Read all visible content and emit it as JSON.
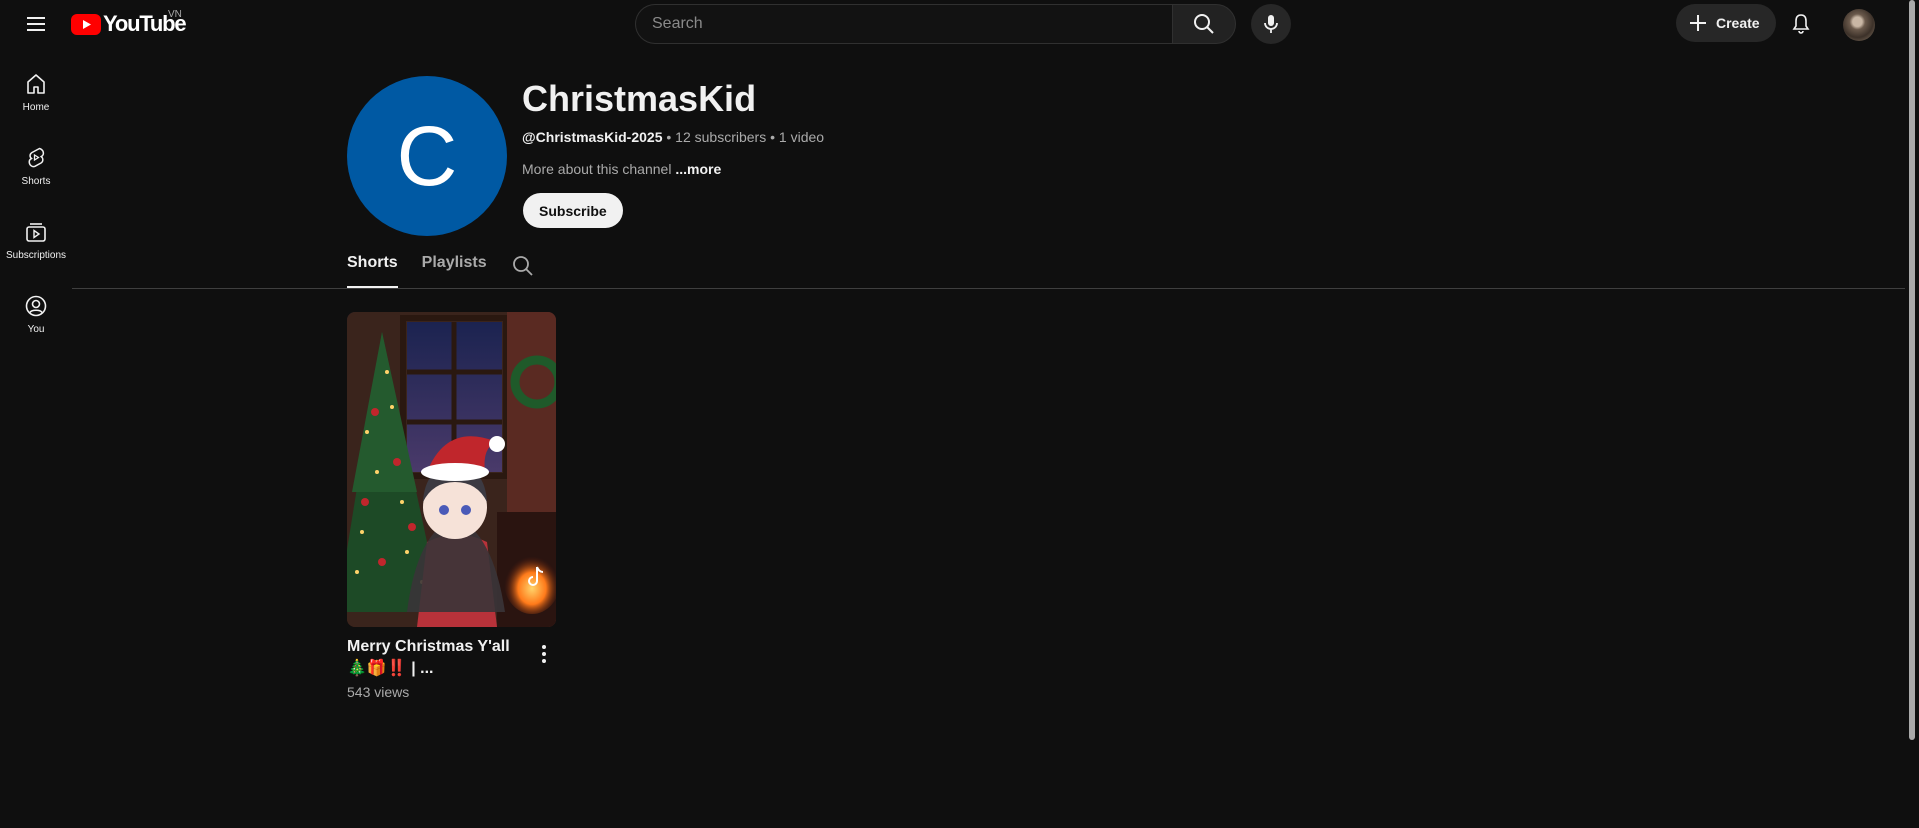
{
  "topbar": {
    "logo_text": "YouTube",
    "country_code": "VN",
    "search_placeholder": "Search",
    "create_label": "Create",
    "brand_color": "#ff0000"
  },
  "guide": {
    "items": [
      {
        "label": "Home",
        "icon": "home-icon"
      },
      {
        "label": "Shorts",
        "icon": "shorts-icon"
      },
      {
        "label": "Subscriptions",
        "icon": "subscriptions-icon"
      },
      {
        "label": "You",
        "icon": "you-icon"
      }
    ]
  },
  "channel": {
    "avatar_letter": "C",
    "avatar_color": "#0059a3",
    "title": "ChristmasKid",
    "handle": "@ChristmasKid-2025",
    "subscribers": "12 subscribers",
    "videos": "1 video",
    "meta_sep": " • ",
    "description": "More about this channel",
    "more_label": "...more",
    "subscribe_label": "Subscribe"
  },
  "tabs": [
    {
      "label": "Shorts",
      "active": true
    },
    {
      "label": "Playlists",
      "active": false
    }
  ],
  "shorts": [
    {
      "title": "Merry Christmas Y'all 🎄🎁‼️ | ...",
      "views": "543 views"
    }
  ]
}
